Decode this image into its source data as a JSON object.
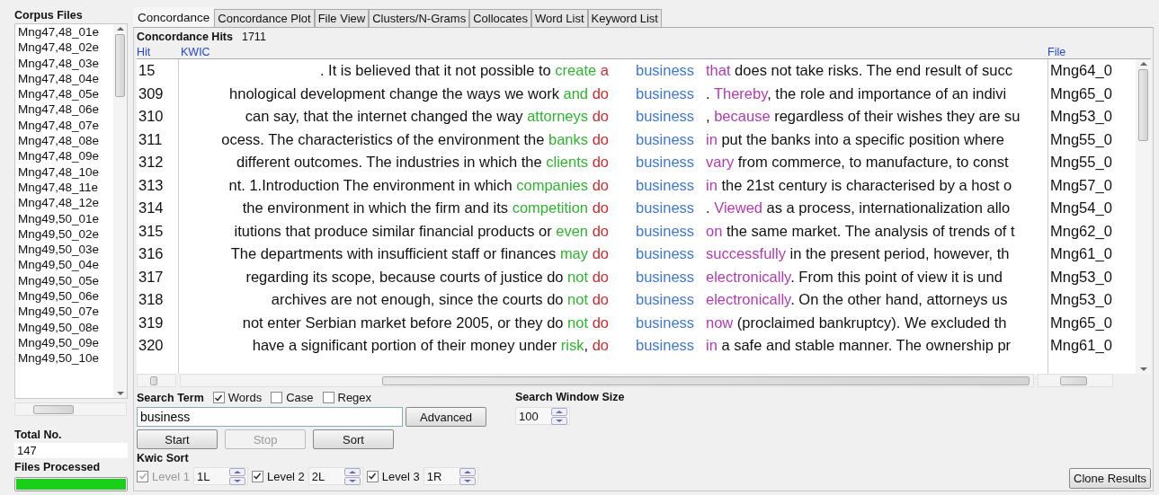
{
  "corpus_files": {
    "title": "Corpus Files",
    "items": [
      "Mng47,48_01e",
      "Mng47,48_02e",
      "Mng47,48_03e",
      "Mng47,48_04e",
      "Mng47,48_05e",
      "Mng47,48_06e",
      "Mng47,48_07e",
      "Mng47,48_08e",
      "Mng47,48_09e",
      "Mng47,48_10e",
      "Mng47,48_11e",
      "Mng47,48_12e",
      "Mng49,50_01e",
      "Mng49,50_02e",
      "Mng49,50_03e",
      "Mng49,50_04e",
      "Mng49,50_05e",
      "Mng49,50_06e",
      "Mng49,50_07e",
      "Mng49,50_08e",
      "Mng49,50_09e",
      "Mng49,50_10e"
    ],
    "total_label": "Total No.",
    "total": "147",
    "processed": {
      "label": "Files Processed",
      "level": 1
    }
  },
  "tabs": [
    {
      "label": "Concordance",
      "selected": true
    },
    {
      "label": "Concordance Plot",
      "selected": false
    },
    {
      "label": "File View",
      "selected": false
    },
    {
      "label": "Clusters/N-Grams",
      "selected": false
    },
    {
      "label": "Collocates",
      "selected": false
    },
    {
      "label": "Word List",
      "selected": false
    },
    {
      "label": "Keyword List",
      "selected": false
    }
  ],
  "hits_label": "Concordance Hits",
  "hits": "1711",
  "columns": {
    "hit": "Hit",
    "kwic": "KWIC",
    "file": "File"
  },
  "rows": [
    {
      "hit": "15",
      "left": ". It is believed that it not possible to",
      "l2": "create",
      "l1": "a",
      "key": "business",
      "r1": "that",
      "right": " does not take risks. The end result of succ",
      "file": "Mng64_0"
    },
    {
      "hit": "309",
      "left": "hnological development change the ways we work",
      "l2": "and",
      "l1": "do",
      "key": "business",
      "r1_punct": ". ",
      "r1": "Thereby",
      "right": ", the role and importance of an indivi",
      "file": "Mng65_0"
    },
    {
      "hit": "310",
      "left": "can say, that the internet changed the way",
      "l2": "attorneys",
      "l1": "do",
      "key": "business",
      "r1_punct": ", ",
      "r1": "because",
      "right": " regardless of their wishes they are su",
      "file": "Mng53_0"
    },
    {
      "hit": "311",
      "left": "ocess. The characteristics of the environment the",
      "l2": "banks",
      "l1": "do",
      "key": "business",
      "r1": "in",
      "right": " put the banks into a specific position where",
      "file": "Mng55_0"
    },
    {
      "hit": "312",
      "left": "different outcomes. The industries in which the",
      "l2": "clients",
      "l1": "do",
      "key": "business",
      "r1": "vary",
      "right": " from commerce, to manufacture, to const",
      "file": "Mng55_0"
    },
    {
      "hit": "313",
      "left": "nt. 1.Introduction The environment in which",
      "l2": "companies",
      "l1": "do",
      "key": "business",
      "r1": "in",
      "right": " the 21st century is characterised by a host o",
      "file": "Mng57_0"
    },
    {
      "hit": "314",
      "left": "the environment in which the firm and its",
      "l2": "competition",
      "l1": "do",
      "key": "business",
      "r1_punct": ". ",
      "r1": "Viewed",
      "right": " as a process, internationalization allo",
      "file": "Mng54_0"
    },
    {
      "hit": "315",
      "left": "itutions that produce similar financial products or",
      "l2": "even",
      "l1": "do",
      "key": "business",
      "r1": "on",
      "right": " the same market. The analysis of trends of t",
      "file": "Mng62_0"
    },
    {
      "hit": "316",
      "left": "The departments with insufficient staff or finances",
      "l2": "may",
      "l1": "do",
      "key": "business",
      "r1": "successfully",
      "right": " in the present period, however, th",
      "file": "Mng61_0"
    },
    {
      "hit": "317",
      "left": "regarding its scope, because courts of justice do",
      "l2": "not",
      "l1": "do",
      "key": "business",
      "r1": "electronically",
      "right": ". From this point of view it is und",
      "file": "Mng53_0"
    },
    {
      "hit": "318",
      "left": "archives are not enough, since the courts do",
      "l2": "not",
      "l1": "do",
      "key": "business",
      "r1": "electronically",
      "right": ". On the other hand, attorneys us",
      "file": "Mng53_0"
    },
    {
      "hit": "319",
      "left": "not enter Serbian market before 2005, or they do",
      "l2": "not",
      "l1": "do",
      "key": "business",
      "r1": "now",
      "right": " (proclaimed bankruptcy). We excluded th",
      "file": "Mng65_0"
    },
    {
      "hit": "320",
      "left": "have a significant portion of their money under",
      "l2": "risk",
      "l2_punct": ",",
      "l1": "do",
      "key": "business",
      "r1": "in",
      "right": " a safe and stable manner. The ownership pr",
      "file": "Mng61_0"
    }
  ],
  "search": {
    "label": "Search Term",
    "options": [
      {
        "label": "Words",
        "checked": true
      },
      {
        "label": "Case",
        "checked": false
      },
      {
        "label": "Regex",
        "checked": false
      }
    ],
    "value": "business",
    "advanced": "Advanced",
    "window_label": "Search Window Size",
    "window": "100"
  },
  "buttons": [
    {
      "label": "Start",
      "disabled": false
    },
    {
      "label": "Stop",
      "disabled": true
    },
    {
      "label": "Sort",
      "disabled": false
    }
  ],
  "kwic_sort": {
    "label": "Kwic Sort",
    "levels": [
      {
        "label": "Level 1",
        "checked": true,
        "disabled": true,
        "value": "1L"
      },
      {
        "label": "Level 2",
        "checked": true,
        "disabled": false,
        "value": "2L"
      },
      {
        "label": "Level 3",
        "checked": true,
        "disabled": false,
        "value": "1R"
      }
    ]
  },
  "clone": "Clone Results"
}
